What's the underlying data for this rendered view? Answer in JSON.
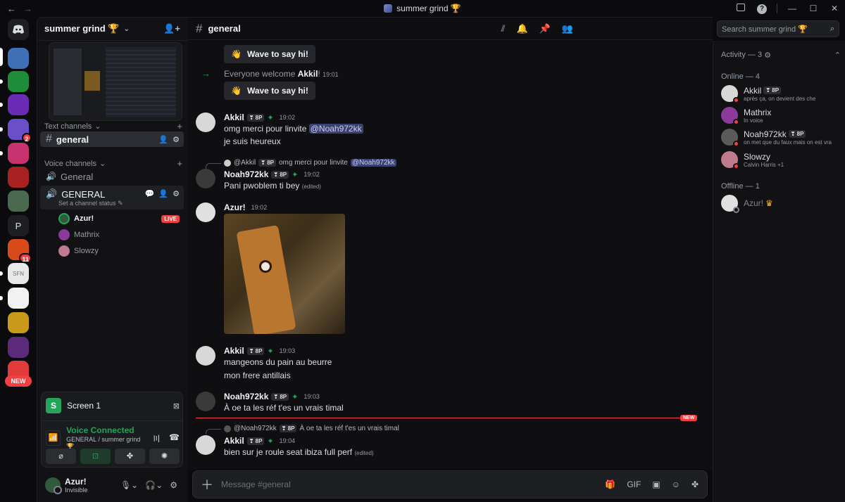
{
  "window": {
    "title": "summer grind 🏆"
  },
  "servers": [
    {
      "name": "server-1",
      "color": "#3f6fb5",
      "badge": ""
    },
    {
      "name": "server-2",
      "color": "#1f8c3a",
      "badge": ""
    },
    {
      "name": "server-3",
      "color": "#6a2bb5",
      "badge": ""
    },
    {
      "name": "server-4",
      "color": "#6b4fc8",
      "badge": "2"
    },
    {
      "name": "server-5",
      "color": "#c8326f",
      "badge": ""
    },
    {
      "name": "server-6",
      "color": "#a82222",
      "badge": ""
    },
    {
      "name": "server-7",
      "color": "#4a6a4f",
      "badge": ""
    },
    {
      "name": "server-p",
      "color": "#1e1f22",
      "badge": ""
    },
    {
      "name": "server-9",
      "color": "#d94a1b",
      "badge": "11"
    },
    {
      "name": "server-sfn",
      "color": "#e8e8e8",
      "badge": ""
    },
    {
      "name": "server-11",
      "color": "#f2f2f2",
      "badge": ""
    },
    {
      "name": "server-12",
      "color": "#c99a1a",
      "badge": ""
    },
    {
      "name": "server-13",
      "color": "#5b2a7a",
      "badge": ""
    },
    {
      "name": "server-14",
      "color": "#e03a3a",
      "badge": ""
    }
  ],
  "server_labels": {
    "p": "P",
    "sfn": "SFN",
    "new": "NEW"
  },
  "guild": {
    "name": "summer grind 🏆"
  },
  "categories": {
    "text": "Text channels",
    "voice": "Voice channels"
  },
  "channels": {
    "general_text": "general",
    "general_voice_lower": "General",
    "general_voice_upper": "GENERAL",
    "voice_status": "Set a channel status"
  },
  "voice_users": [
    {
      "name": "Azur!",
      "live": "LIVE"
    },
    {
      "name": "Mathrix",
      "live": ""
    },
    {
      "name": "Slowzy",
      "live": ""
    }
  ],
  "rtc": {
    "screen": "Screen 1",
    "screen_letter": "S",
    "status": "Voice Connected",
    "location": "GENERAL / summer grind 🏆"
  },
  "user": {
    "name": "Azur!",
    "status": "Invisible"
  },
  "chat": {
    "channel": "general",
    "search_placeholder": "Search summer grind 🏆",
    "composer_placeholder": "Message #general",
    "wave_label": "Wave to say hi!",
    "welcome_prefix": "Everyone welcome ",
    "welcome_user": "Akkil",
    "welcome_time": "19:01",
    "new_label": "NEW",
    "edited": "(edited)",
    "tag": "8P",
    "messages": [
      {
        "author": "Akkil",
        "time": "19:02",
        "lines": [
          "omg merci pour linvite",
          "je suis heureux"
        ],
        "mention": "@Noah972kk"
      },
      {
        "reply_author": "@Akkil",
        "reply_text": "omg merci pour linvite",
        "reply_mention": "@Noah972kk",
        "author": "Noah972kk",
        "time": "19:02",
        "line": "Pani pwoblem ti bey"
      },
      {
        "author": "Azur!",
        "time": "19:02"
      },
      {
        "author": "Akkil",
        "time": "19:03",
        "lines": [
          "mangeons du pain au beurre",
          "mon frere antillais"
        ]
      },
      {
        "author": "Noah972kk",
        "time": "19:03",
        "line": "À oe ta les réf t'es un vrais timal"
      },
      {
        "reply_author": "@Noah972kk",
        "reply_text": "À oe ta les réf t'es un vrais timal",
        "author": "Akkil",
        "time": "19:04",
        "line": "bien sur je roule seat ibiza full perf"
      }
    ]
  },
  "members": {
    "activity": "Activity — 3",
    "online_header": "Online — 4",
    "offline_header": "Offline — 1",
    "online": [
      {
        "name": "Akkil",
        "tag": "8P",
        "sub": "après ça, on devient des che",
        "color": "#d8d8d8"
      },
      {
        "name": "Mathrix",
        "tag": "",
        "sub": "In voice",
        "color": "#8a3b9a"
      },
      {
        "name": "Noah972kk",
        "tag": "8P",
        "sub": "on met que du faux mais on est vra",
        "color": "#5a5a5a"
      },
      {
        "name": "Slowzy",
        "tag": "",
        "sub": "Calvin Harris +1",
        "color": "#c07a8e"
      }
    ],
    "offline": [
      {
        "name": "Azur!",
        "color": "#e0e0e0"
      }
    ]
  }
}
